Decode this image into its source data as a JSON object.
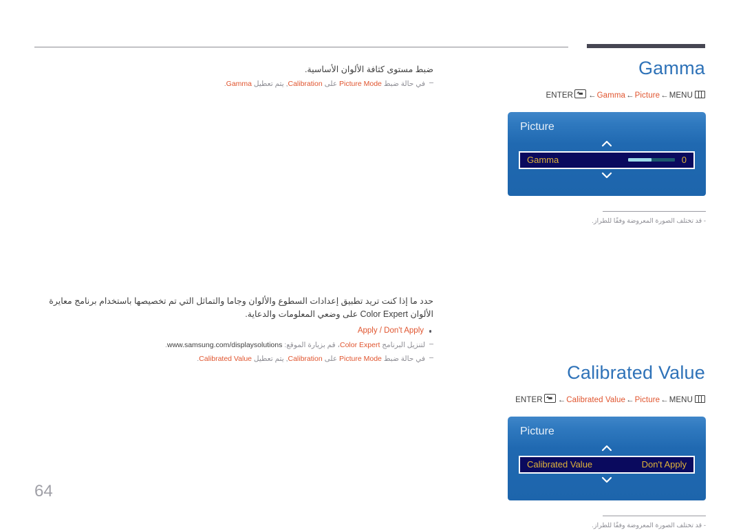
{
  "page": {
    "number": "64"
  },
  "sections": [
    {
      "id": "gamma",
      "title": "Gamma",
      "breadcrumb": {
        "enter_label": "ENTER",
        "enter_icon": "enter-key-icon",
        "arrow": "←",
        "crumb_1": "Gamma",
        "crumb_2": "Picture",
        "menu_label": "MENU",
        "menu_icon": "menu-key-icon"
      },
      "osd": {
        "title": "Picture",
        "up_icon": "chevron-up-icon",
        "down_icon": "chevron-down-icon",
        "row": {
          "label": "Gamma",
          "value": "0",
          "slider_percent": 50,
          "slider_track_color": "#1c5a6e",
          "slider_fill_color": "#9ddbe8"
        },
        "accent_text_color": "#e0b33a",
        "row_bg_color": "#0a0a5e"
      },
      "footnote": "قد تختلف الصورة المعروضة وفقًا للطراز.",
      "body": {
        "lead": "ضبط مستوى كثافة الألوان الأساسية.",
        "notes": [
          {
            "pre": "في حالة ضبط ",
            "en1": "Picture Mode",
            "mid1": " على ",
            "en2": "Calibration",
            "mid2": ", يتم تعطيل ",
            "en3": "Gamma",
            "post": "."
          }
        ]
      }
    },
    {
      "id": "calibrated-value",
      "title": "Calibrated Value",
      "breadcrumb": {
        "enter_label": "ENTER",
        "enter_icon": "enter-key-icon",
        "arrow": "←",
        "crumb_1": "Calibrated Value",
        "crumb_2": "Picture",
        "menu_label": "MENU",
        "menu_icon": "menu-key-icon"
      },
      "osd": {
        "title": "Picture",
        "up_icon": "chevron-up-icon",
        "down_icon": "chevron-down-icon",
        "row": {
          "label": "Calibrated Value",
          "value": "Don't Apply"
        },
        "accent_text_color": "#e0b33a",
        "row_bg_color": "#0a0a5e"
      },
      "footnote": "قد تختلف الصورة المعروضة وفقًا للطراز.",
      "body": {
        "lead": "حدد ما إذا كنت تريد تطبيق إعدادات السطوع والألوان وجاما والتماثل التي تم تخصيصها باستخدام برنامج معايرة الألوان Color Expert على وضعي المعلومات والدعاية.",
        "bullet": "Apply / Don't Apply",
        "notes": [
          {
            "pre": "لتنزيل البرنامج ",
            "en1": "Color Expert",
            "mid1": "، قم بزيارة الموقع: ",
            "url": "www.samsung.com/displaysolutions",
            "post": "."
          },
          {
            "pre": "في حالة ضبط ",
            "en1": "Picture Mode",
            "mid1": " على ",
            "en2": "Calibration",
            "mid2": ", يتم تعطيل ",
            "en3": "Calibrated Value",
            "post": "."
          }
        ]
      }
    }
  ],
  "colors": {
    "title_blue": "#2e72b8",
    "accent_orange": "#e0542e",
    "osd_blue_top": "#3f86c9",
    "osd_blue_bottom": "#1d65ac",
    "page_number_gray": "#a0a0a7"
  }
}
